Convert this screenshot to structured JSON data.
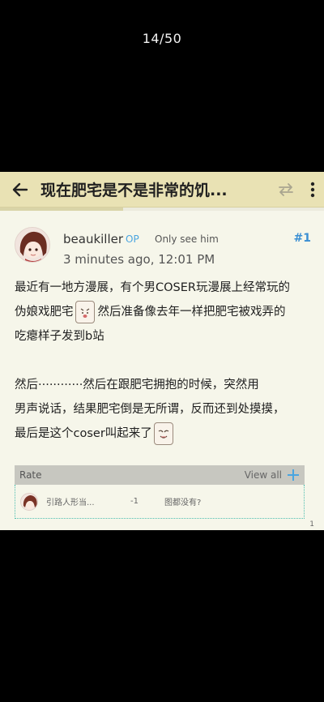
{
  "viewer": {
    "counter": "14/50"
  },
  "topbar": {
    "title": "现在肥宅是不是非常的饥...",
    "progress_fraction": 0.38
  },
  "post": {
    "username": "beaukiller",
    "op_badge": "OP",
    "only_see": "Only see him",
    "number": "#1",
    "time": "3 minutes ago, 12:01 PM",
    "lines": {
      "l1": "最近有一地方漫展，有个男COSER玩漫展上经常玩的",
      "l2a": "伪娘戏肥宅",
      "l2b": "然后准备像去年一样把肥宅被戏弄的",
      "l3": "吃瘪样子发到b站",
      "l4": "然后············然后在跟肥宅拥抱的时候，突然用",
      "l5": "男声说话，结果肥宅倒是无所谓，反而还到处摸摸，",
      "l6": "最后是这个coser叫起来了"
    }
  },
  "rate": {
    "title": "Rate",
    "view_all": "View all",
    "entries": [
      {
        "user": "引路人形当...",
        "score": "-1",
        "comment": "图都没有?"
      }
    ]
  },
  "page_indicator": "1",
  "colors": {
    "topbar": "#e9e2b4",
    "background": "#f6f6ea",
    "accent": "#4aa5e0",
    "post_number": "#3b8fd3"
  }
}
